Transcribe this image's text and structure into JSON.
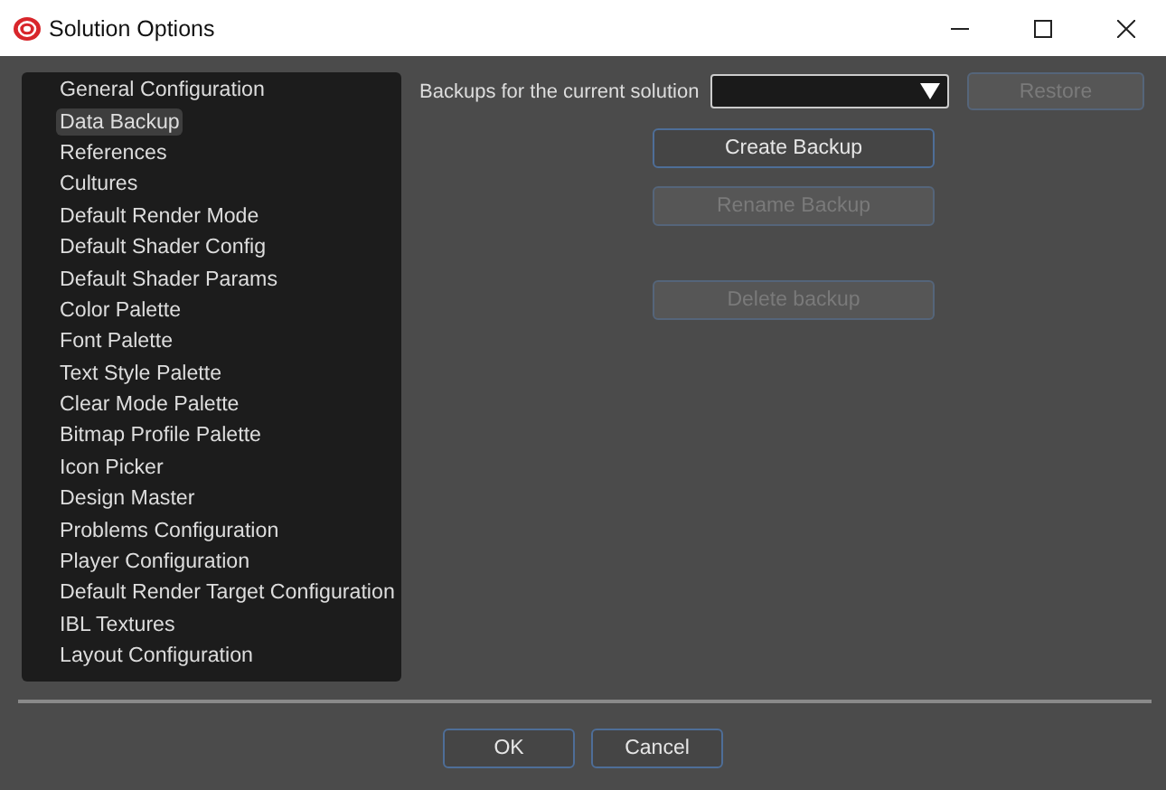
{
  "window": {
    "title": "Solution Options"
  },
  "sidebar": {
    "items": [
      {
        "label": "General Configuration",
        "selected": false
      },
      {
        "label": "Data Backup",
        "selected": true
      },
      {
        "label": "References",
        "selected": false
      },
      {
        "label": "Cultures",
        "selected": false
      },
      {
        "label": "Default Render Mode",
        "selected": false
      },
      {
        "label": "Default Shader Config",
        "selected": false
      },
      {
        "label": "Default Shader Params",
        "selected": false
      },
      {
        "label": "Color Palette",
        "selected": false
      },
      {
        "label": "Font Palette",
        "selected": false
      },
      {
        "label": "Text Style Palette",
        "selected": false
      },
      {
        "label": "Clear Mode Palette",
        "selected": false
      },
      {
        "label": "Bitmap Profile Palette",
        "selected": false
      },
      {
        "label": "Icon Picker",
        "selected": false
      },
      {
        "label": "Design Master",
        "selected": false
      },
      {
        "label": "Problems Configuration",
        "selected": false
      },
      {
        "label": "Player Configuration",
        "selected": false
      },
      {
        "label": "Default Render Target Configuration",
        "selected": false
      },
      {
        "label": "IBL Textures",
        "selected": false
      },
      {
        "label": "Layout Configuration",
        "selected": false
      }
    ]
  },
  "backup": {
    "label": "Backups for the current solution",
    "restore": {
      "label": "Restore",
      "disabled": true
    },
    "actions": [
      {
        "label": "Create Backup",
        "disabled": false
      },
      {
        "label": "Rename Backup",
        "disabled": true
      },
      {
        "label": "Delete backup",
        "disabled": true
      }
    ]
  },
  "footer": {
    "buttons": [
      {
        "label": "OK"
      },
      {
        "label": "Cancel"
      }
    ]
  }
}
